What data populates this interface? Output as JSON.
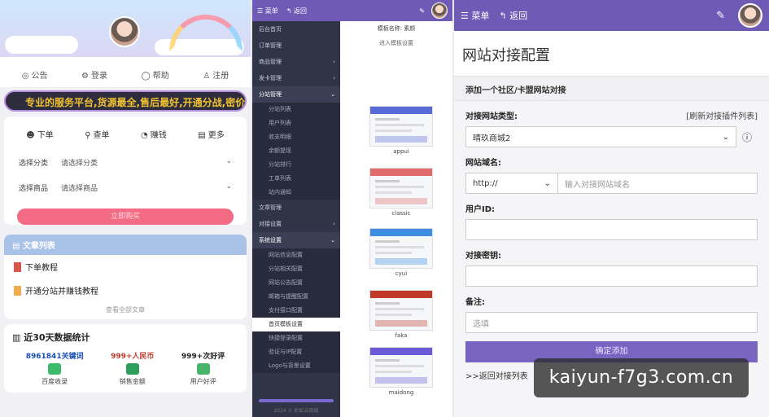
{
  "left_panel": {
    "topnav": [
      {
        "icon": "notice-icon",
        "glyph": "◎",
        "label": "公告"
      },
      {
        "icon": "login-icon",
        "glyph": "⚙",
        "label": "登录"
      },
      {
        "icon": "help-icon",
        "glyph": "◯",
        "label": "帮助"
      },
      {
        "icon": "register-icon",
        "glyph": "♙",
        "label": "注册"
      }
    ],
    "marquee": "专业的服务平台,货源最全,售后最好,开通分战,密价",
    "quicknav": [
      {
        "glyph": "☻",
        "label": "下单"
      },
      {
        "glyph": "⚲",
        "label": "查单"
      },
      {
        "glyph": "◔",
        "label": "赚钱"
      },
      {
        "glyph": "▤",
        "label": "更多"
      }
    ],
    "category_label": "选择分类",
    "category_value": "请选择分类",
    "product_label": "选择商品",
    "product_value": "请选择商品",
    "buy_button": "立即购买",
    "articles": {
      "title": "文章列表",
      "items": [
        "下单教程",
        "开通分站并赚钱教程"
      ],
      "more": "查看全部文章"
    },
    "stats": {
      "title": "近30天数据统计",
      "items": [
        {
          "value": "8961841关键词",
          "label": "百度收录",
          "color": "#1a4fb8",
          "icon_color": "#3dbb6c"
        },
        {
          "value": "999+人民币",
          "label": "销售金额",
          "color": "#c0392b",
          "icon_color": "#2e9e5b"
        },
        {
          "value": "999+次好评",
          "label": "用户好评",
          "color": "#222222",
          "icon_color": "#48b36a"
        }
      ]
    }
  },
  "mid_panel": {
    "menu_label": "菜单",
    "back_label": "返回",
    "sidebar": [
      {
        "type": "it",
        "label": "后台首页"
      },
      {
        "type": "it",
        "label": "订单管理"
      },
      {
        "type": "it",
        "label": "商品管理",
        "arrow": "›"
      },
      {
        "type": "it",
        "label": "发卡管理",
        "arrow": "›"
      },
      {
        "type": "head",
        "label": "分站管理",
        "arrow": "⌄"
      },
      {
        "type": "sub",
        "label": "分站列表"
      },
      {
        "type": "sub",
        "label": "用户列表"
      },
      {
        "type": "sub",
        "label": "收支明细"
      },
      {
        "type": "sub",
        "label": "余额提现"
      },
      {
        "type": "sub",
        "label": "分站排行"
      },
      {
        "type": "sub",
        "label": "工单列表"
      },
      {
        "type": "sub",
        "label": "站内通知"
      },
      {
        "type": "it",
        "label": "文章管理"
      },
      {
        "type": "it",
        "label": "对接设置",
        "arrow": "›"
      },
      {
        "type": "head",
        "label": "系统设置",
        "arrow": "⌄"
      },
      {
        "type": "sub",
        "label": "网站信息配置"
      },
      {
        "type": "sub",
        "label": "分站相关配置"
      },
      {
        "type": "sub",
        "label": "网站公告配置"
      },
      {
        "type": "sub",
        "label": "邮箱与提醒配置"
      },
      {
        "type": "sub",
        "label": "支付接口配置"
      },
      {
        "type": "sub",
        "label": "首页模板设置",
        "active": true
      },
      {
        "type": "sub",
        "label": "快捷登录配置"
      },
      {
        "type": "sub",
        "label": "验证与IP配置"
      },
      {
        "type": "sub",
        "label": "Logo与背景设置"
      }
    ],
    "footer": "2024 © 彩虹云商城",
    "template_header": "模板名称: 素颜",
    "template_link": "进入模板设置",
    "templates": [
      {
        "name": "appui",
        "accent": "#5a6ad8"
      },
      {
        "name": "classic",
        "accent": "#e06a6a"
      },
      {
        "name": "cyui",
        "accent": "#3d8ee0"
      },
      {
        "name": "faka",
        "accent": "#c0392b"
      },
      {
        "name": "maidong",
        "accent": "#6b5bd6"
      }
    ]
  },
  "right_panel": {
    "menu_label": "菜单",
    "back_label": "返回",
    "title": "网站对接配置",
    "subtitle": "添加一个社区/卡盟网站对接",
    "type_label": "对接网站类型:",
    "refresh_link": "[刷新对接插件列表]",
    "type_value": "晴玖商城2",
    "domain_label": "网站域名:",
    "protocol": "http://",
    "domain_placeholder": "输入对接网站域名",
    "userid_label": "用户ID:",
    "key_label": "对接密钥:",
    "note_label": "备注:",
    "note_placeholder": "选填",
    "submit": "确定添加",
    "back_link": ">>返回对接列表"
  },
  "watermark": "kaiyun-f7g3.com.cn"
}
